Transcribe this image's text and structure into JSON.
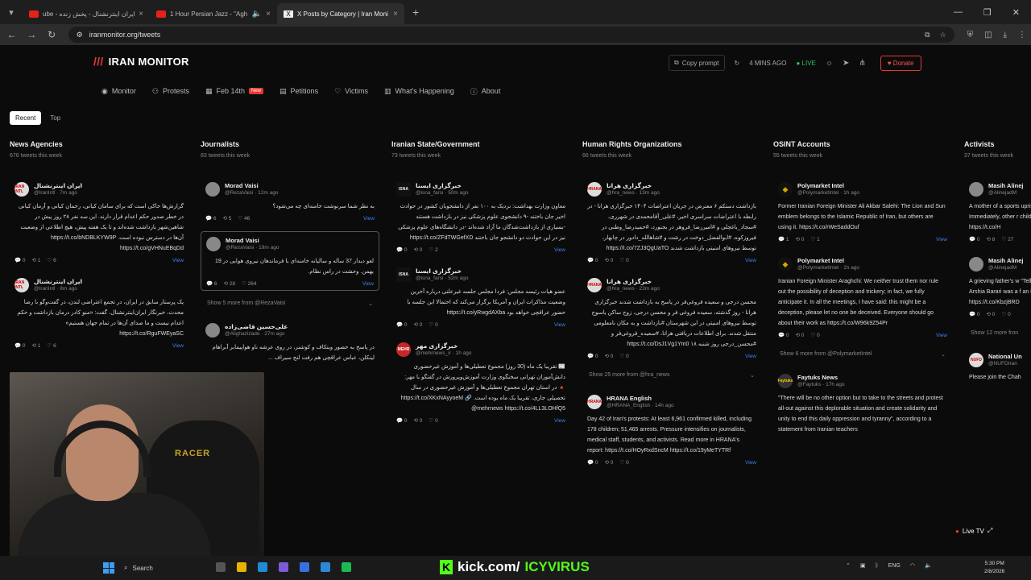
{
  "browser": {
    "tabs": [
      {
        "title": "ube - ایران اینترنشنال - پخش زنده",
        "active": false
      },
      {
        "title": "1 Hour Persian Jazz - \"Agh",
        "active": false
      },
      {
        "title": "X Posts by Category | Iran Moni",
        "active": true
      }
    ],
    "url": "iranmonitor.org/tweets"
  },
  "site": {
    "logo": "IRAN MONITOR",
    "copy_prompt": "Copy prompt",
    "updated": "4 MINS AGO",
    "live": "LIVE",
    "donate": "Donate",
    "nav": [
      {
        "label": "Monitor",
        "icon": "eye-icon"
      },
      {
        "label": "Protests",
        "icon": "people-icon"
      },
      {
        "label": "Feb 14th",
        "icon": "calendar-icon",
        "badge": "New"
      },
      {
        "label": "Petitions",
        "icon": "document-icon"
      },
      {
        "label": "Victims",
        "icon": "heart-icon"
      },
      {
        "label": "What's Happening",
        "icon": "book-icon"
      },
      {
        "label": "About",
        "icon": "info-icon"
      }
    ],
    "toggle": {
      "recent": "Recent",
      "top": "Top"
    }
  },
  "columns": [
    {
      "title": "News Agencies",
      "count": "676 tweets this week",
      "cards": [
        {
          "name": "ایران اینترنشنال",
          "handle": "@IranIntl · 7m ago",
          "av": "white",
          "avtext": "IRAN INTL",
          "rtl": true,
          "text": "گزارش‌ها حاکی است که برای سامان کیانی، رحمان کیانی و آرمان کیانی در خطر صدور حکم اعدام قرار دارند. این سه نفر ۲۸ روز پیش در شاهین‌شهر بازداشت شده‌اند و تا یک هفته پیش، هیچ اطلاعی از وضعیت آن‌ها در دسترس نبوده است. https://t.co/bNDBLKYW9P https://t.co/gVHNuEBqDd",
          "r": "0",
          "rt": "1",
          "l": "6",
          "view": "View"
        },
        {
          "name": "ایران اینترنشنال",
          "handle": "@IranIntl · 8m ago",
          "av": "white",
          "avtext": "IRAN INTL",
          "rtl": true,
          "text": "یک پرستار سابق در ایران، در تجمع اعتراضی لندن، در گفت‌وگو با رضا محدث، خبرنگار ایران‌اینترنشنال، گفت: «منو کادر درمان بازداشت و حکم اعدام نیست و ما صدای آن‌ها در تمام جهان هستیم» https://t.co/RguFWEyaSC",
          "r": "0",
          "rt": "1",
          "l": "6",
          "view": "View"
        }
      ]
    },
    {
      "title": "Journalists",
      "count": "83 tweets this week",
      "cards": [
        {
          "name": "Morad Vaisi",
          "handle": "@RezaVaisi · 12m ago",
          "av": "grey",
          "avtext": "",
          "rtl": true,
          "text": "به نظر شما سرنوشت خامنه‌ای چه می‌شود؟",
          "r": "6",
          "rt": "5",
          "l": "46",
          "view": "View"
        },
        {
          "name": "Morad Vaisi",
          "handle": "@RezaVaisi · 19m ago",
          "av": "grey",
          "avtext": "",
          "rtl": true,
          "hl": true,
          "text": "لغو دیدار 37 ساله و سالیانه خامنه‌ای با فرماندهان نیروی هوایی در 19 بهمن. وحشت در راس نظام.",
          "r": "6",
          "rt": "28",
          "l": "264",
          "view": "View"
        }
      ],
      "more": "Show 5 more from @RezaVaisi",
      "cards2": [
        {
          "name": "علی‌حسین قاضی‌زاده",
          "handle": "@Alighazizade · 27m ago",
          "av": "grey",
          "avtext": "",
          "rtl": true,
          "text": "در پاسخ به حضور ویتکاف و کوشنر، در روی عرشه ناو هواپیمابر آبراهام لینکلن، عباس عراقچی هم رفت لنج سیراف ...",
          "r": "",
          "rt": "",
          "l": "",
          "view": "View"
        }
      ]
    },
    {
      "title": "Iranian State/Government",
      "count": "73 tweets this week",
      "cards": [
        {
          "name": "خبرگزاری ایسنا",
          "handle": "@isna_farsi · 50m ago",
          "av": "isna",
          "avtext": "ISNA",
          "rtl": true,
          "text": "معاون وزارت بهداشت: نزدیک به ۱۰۰ نفر از دانشجویان کشور در حوادث اخیر جان باختند -۹ دانشجوی علوم پزشکی نیز در بازداشت هستند -بسیاری از بازداشت‌شدگان ما آزاد شده‌اند -در دانشگاه‌های علوم پزشکی نیز در این حوادث دو دانشجو جان باختند https://t.co/ZFdTWGefXD",
          "r": "0",
          "rt": "0",
          "l": "2",
          "view": "View"
        },
        {
          "name": "خبرگزاری ایسنا",
          "handle": "@isna_farsi · 52m ago",
          "av": "isna",
          "avtext": "ISNA",
          "rtl": true,
          "text": "عضو هیات رئیسه مجلس: فردا مجلس جلسه غیرعلنی درباره آخرین وضعیت مذاکرات ایران و آمریکا برگزار می‌کند که احتمالا این جلسه با حضور عراقچی خواهد بود https://t.co/yRwgdAXba",
          "r": "0",
          "rt": "0",
          "l": "0",
          "view": "View"
        },
        {
          "name": "خبرگزاری مهر",
          "handle": "@mehrnews_ir · 1h ago",
          "av": "red",
          "avtext": "MEHR",
          "rtl": true,
          "text": "📰 تقریبا یک ماه (30 روز) مجموع تعطیلی‌ها و آموزش غیرحضوری دانش‌آموزان تهرانی سخنگوی وزارت آموزش‌وپرورش در گفتگو با مهر: 🔺 در استان تهران مجموع تعطیلی‌ها و آموزش غیرحضوری در سال تحصیلی جاری، تقریبا یک ماه بوده است. https://t.co/XKxNAyyoeM 🔗 mehrnews https://t.co/4LL3LOHfQ5@",
          "r": "0",
          "rt": "0",
          "l": "0",
          "view": "View"
        }
      ]
    },
    {
      "title": "Human Rights Organizations",
      "count": "66 tweets this week",
      "cards": [
        {
          "name": "خبرگزاری هرانا",
          "handle": "@hra_news · 13m ago",
          "av": "white",
          "avtext": "HRANA",
          "rtl": true,
          "text": "بازداشت دستکم ۶ معترض در جریان اعتراضات ۱۴۰۴ خبرگزاری هرانا - در رابطه با اعتراضات سراسری اخیر، #علی_آقامحمدی در شهرری، #سجاد_باغچلی و #امیررضا_فروهر در بجنورد، #حمیدرضا_وطنی در فیروزکوه، #ابوالفضل_دوخت در رشت و #شاهالله_دادور در چابهار، توسط نیروهای امنیتی بازداشت شدند https://t.co/7ZJ3QgUaTO",
          "r": "0",
          "rt": "0",
          "l": "0",
          "view": "View"
        },
        {
          "name": "خبرگزاری هرانا",
          "handle": "@hra_news · 23m ago",
          "av": "white",
          "avtext": "HRANA",
          "rtl": true,
          "text": "محسن درجی و سعیده فروغی‌فر در پاسخ به بازداشت شدند خبرگزاری هرانا - روز گذشته، سعیده فروغی فر و محسن درجی، زوج ساکن یاسوج توسط نیروهای امنیتی در این شهرستان #بازداشت و به مکان نامعلومی منتقل شدند. برای اطلاعات دریافتی هرانا، #سعیده_فروغی‌فر و #محسن_درجی روز شنبه ۱۸ https://t.co/DsJ1Vg1Ym0",
          "r": "0",
          "rt": "0",
          "l": "0",
          "view": "View"
        }
      ],
      "more": "Show 25 more from @hra_news",
      "cards2": [
        {
          "name": "HRANA English",
          "handle": "@HRANA_English · 14h ago",
          "av": "white",
          "avtext": "HRANA",
          "rtl": false,
          "text": "Day 42 of Iran's protests: At least 6,961 confirmed killed, including 178 children; 51,465 arrests. Pressure intensifies on journalists, medical staff, students, and activists. Read more in HRANA's report: https://t.co/HOyRxdSncM https://t.co/19yMeTYTRf",
          "r": "0",
          "rt": "0",
          "l": "0",
          "view": "View"
        }
      ]
    },
    {
      "title": "OSINT Accounts",
      "count": "55 tweets this week",
      "cards": [
        {
          "name": "Polymarket Intel",
          "handle": "@PolymarketIntel · 1h ago",
          "av": "pm",
          "avtext": "◆",
          "rtl": false,
          "text": "Former Iranian Foreign Minister Ali Akbar Salehi: The Lion and Sun emblem belongs to the Islamic Republic of Iran, but others are using it. https://t.co/rWeSaddOuf",
          "r": "1",
          "rt": "0",
          "l": "1",
          "view": "View"
        },
        {
          "name": "Polymarket Intel",
          "handle": "@PolymarketIntel · 1h ago",
          "av": "pm",
          "avtext": "◆",
          "rtl": false,
          "text": "Iranian Foreign Minister Araghchi: We neither trust them nor rule out the possibility of deception and trickery; in fact, we fully anticipate it. In all the meetings, I have said: this might be a deception, please let no one be deceived. Everyone should go about their work as https://t.co/W96k9Z54Pr",
          "r": "0",
          "rt": "0",
          "l": "0",
          "view": "View"
        }
      ],
      "more": "Show 6 more from @PolymarketIntel",
      "cards2": [
        {
          "name": "Faytuks News",
          "handle": "@Faytuks · 17h ago",
          "av": "fy",
          "avtext": "Faytuks",
          "rtl": false,
          "text": "\"There will be no other option but to take to the streets and protest all-out against this deplorable situation and create solidarity and unity to end this daily oppression and tyranny\", according to a statement from Iranian teachers",
          "r": "",
          "rt": "",
          "l": "",
          "view": ""
        }
      ]
    },
    {
      "title": "Activists",
      "count": "37 tweets this week",
      "cards": [
        {
          "name": "Masih Alinej",
          "handle": "@AlinejadM",
          "av": "grey",
          "avtext": "",
          "rtl": false,
          "text": "A mother of a sports uprising stood at the and held her hands, Immediately, other r children's names, na erased. This is https://t.co/H",
          "r": "0",
          "rt": "8",
          "l": "27",
          "view": ""
        },
        {
          "name": "Masih Alinej",
          "handle": "@AlinejadM",
          "av": "grey",
          "avtext": "",
          "rtl": false,
          "text": "A grieving father's w \"Tell the next genera child, mother, father Arshia Barari was a f an international trai On January 8, in Zan https://t.co/KbzjBRD",
          "r": "0",
          "rt": "0",
          "l": "0",
          "view": ""
        }
      ],
      "more": "Show 12 more fron",
      "cards2": [
        {
          "name": "National Un",
          "handle": "@NUFDIran",
          "av": "white",
          "avtext": "NUFD",
          "rtl": false,
          "text": "Please join the Chah",
          "r": "",
          "rt": "",
          "l": "",
          "view": ""
        }
      ]
    }
  ],
  "live_tv": "Live TV",
  "taskbar": {
    "search": "Search",
    "stream_text_prefix": "kick.com/",
    "stream_text_user": "ICYVIRUS",
    "lang": "ENG",
    "time": "5:30 PM",
    "date": "2/8/2026"
  }
}
